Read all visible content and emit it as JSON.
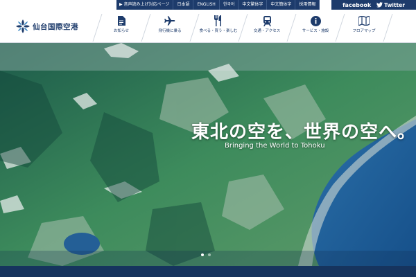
{
  "utility": {
    "links": [
      {
        "label": "音声読み上げ対応ページ",
        "icon": "speaker-icon"
      },
      {
        "label": "日本語"
      },
      {
        "label": "ENGLISH"
      },
      {
        "label": "한국어"
      },
      {
        "label": "中文繁体字"
      },
      {
        "label": "中文簡体字"
      },
      {
        "label": "採用情報"
      }
    ],
    "facebook": "facebook",
    "twitter": "Twitter"
  },
  "logo": {
    "text": "仙台国際空港"
  },
  "nav": [
    {
      "label": "お知らせ",
      "icon": "document-icon"
    },
    {
      "label": "飛行機に乗る",
      "icon": "airplane-icon"
    },
    {
      "label": "食べる・買う・楽しむ",
      "icon": "fork-knife-icon"
    },
    {
      "label": "交通・アクセス",
      "icon": "train-icon"
    },
    {
      "label": "サービス・施設",
      "icon": "info-icon"
    },
    {
      "label": "フロアマップ",
      "icon": "map-icon"
    }
  ],
  "hero": {
    "tagline": "東北の空を、世界の空へ。",
    "subtagline": "Bringing the World to Tohoku",
    "slides_total": 2,
    "slide_active": 1
  },
  "colors": {
    "brand": "#1d3b6b",
    "hero_sea": "#1f5f9e"
  }
}
